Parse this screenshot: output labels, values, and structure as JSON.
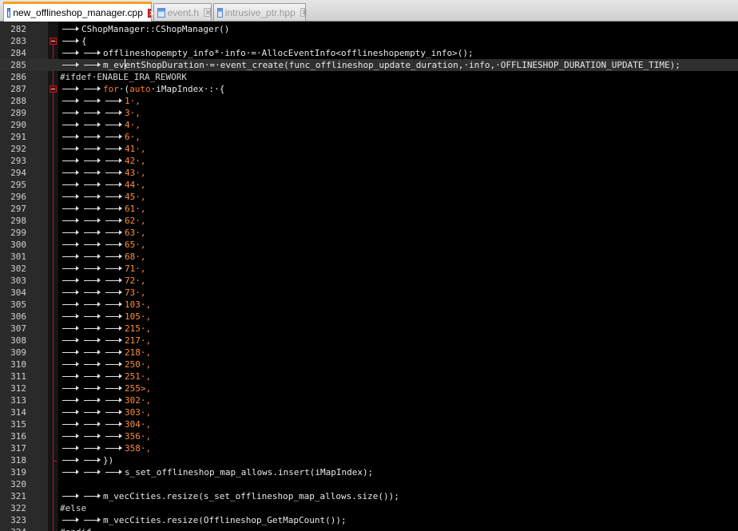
{
  "tabs": [
    {
      "label": "new_offlineshop_manager.cpp",
      "active": true
    },
    {
      "label": "event.h",
      "active": false
    },
    {
      "label": "intrusive_ptr.hpp",
      "active": false
    }
  ],
  "lines": [
    {
      "n": "282",
      "indent": 1,
      "segs": [
        {
          "t": "CShopManager::CShopManager()",
          "c": "plain"
        }
      ]
    },
    {
      "n": "283",
      "indent": 1,
      "segs": [
        {
          "t": "{",
          "c": "plain"
        }
      ]
    },
    {
      "n": "284",
      "indent": 2,
      "segs": [
        {
          "t": "offlineshopempty_info*·info·=·AllocEventInfo<offlineshopempty_info>();",
          "c": "plain"
        }
      ]
    },
    {
      "n": "285",
      "indent": 2,
      "current": true,
      "segs": [
        {
          "t": "m_ev",
          "c": "plain"
        },
        {
          "t": "",
          "c": "cursor"
        },
        {
          "t": "entShopDuration·=·event_create(func_offlineshop_update_duration,·info,·OFFLINESHOP_DURATION_UPDATE_TIME);",
          "c": "plain"
        }
      ]
    },
    {
      "n": "286",
      "indent": 0,
      "segs": [
        {
          "t": "#ifdef·ENABLE_IRA_REWORK",
          "c": "pp"
        }
      ]
    },
    {
      "n": "287",
      "indent": 2,
      "segs": [
        {
          "t": "for",
          "c": "kw"
        },
        {
          "t": "·(",
          "c": "plain"
        },
        {
          "t": "auto",
          "c": "kw"
        },
        {
          "t": "·iMapIndex·:·{",
          "c": "plain"
        }
      ]
    },
    {
      "n": "288",
      "indent": 3,
      "segs": [
        {
          "t": "1·,",
          "c": "num"
        }
      ]
    },
    {
      "n": "289",
      "indent": 3,
      "segs": [
        {
          "t": "3·,",
          "c": "num"
        }
      ]
    },
    {
      "n": "290",
      "indent": 3,
      "segs": [
        {
          "t": "4·,",
          "c": "num"
        }
      ]
    },
    {
      "n": "291",
      "indent": 3,
      "segs": [
        {
          "t": "6·,",
          "c": "num"
        }
      ]
    },
    {
      "n": "292",
      "indent": 3,
      "segs": [
        {
          "t": "41·,",
          "c": "num"
        }
      ]
    },
    {
      "n": "293",
      "indent": 3,
      "segs": [
        {
          "t": "42·,",
          "c": "num"
        }
      ]
    },
    {
      "n": "294",
      "indent": 3,
      "segs": [
        {
          "t": "43·,",
          "c": "num"
        }
      ]
    },
    {
      "n": "295",
      "indent": 3,
      "segs": [
        {
          "t": "44·,",
          "c": "num"
        }
      ]
    },
    {
      "n": "296",
      "indent": 3,
      "segs": [
        {
          "t": "45·,",
          "c": "num"
        }
      ]
    },
    {
      "n": "297",
      "indent": 3,
      "segs": [
        {
          "t": "61·,",
          "c": "num"
        }
      ]
    },
    {
      "n": "298",
      "indent": 3,
      "segs": [
        {
          "t": "62·,",
          "c": "num"
        }
      ]
    },
    {
      "n": "299",
      "indent": 3,
      "segs": [
        {
          "t": "63·,",
          "c": "num"
        }
      ]
    },
    {
      "n": "300",
      "indent": 3,
      "segs": [
        {
          "t": "65·,",
          "c": "num"
        }
      ]
    },
    {
      "n": "301",
      "indent": 3,
      "segs": [
        {
          "t": "68·,",
          "c": "num"
        }
      ]
    },
    {
      "n": "302",
      "indent": 3,
      "segs": [
        {
          "t": "71·,",
          "c": "num"
        }
      ]
    },
    {
      "n": "303",
      "indent": 3,
      "segs": [
        {
          "t": "72·,",
          "c": "num"
        }
      ]
    },
    {
      "n": "304",
      "indent": 3,
      "segs": [
        {
          "t": "73·,",
          "c": "num"
        }
      ]
    },
    {
      "n": "305",
      "indent": 3,
      "segs": [
        {
          "t": "103·,",
          "c": "num"
        }
      ]
    },
    {
      "n": "306",
      "indent": 3,
      "segs": [
        {
          "t": "105·,",
          "c": "num"
        }
      ]
    },
    {
      "n": "307",
      "indent": 3,
      "segs": [
        {
          "t": "215·,",
          "c": "num"
        }
      ]
    },
    {
      "n": "308",
      "indent": 3,
      "segs": [
        {
          "t": "217·,",
          "c": "num"
        }
      ]
    },
    {
      "n": "309",
      "indent": 3,
      "segs": [
        {
          "t": "218·,",
          "c": "num"
        }
      ]
    },
    {
      "n": "310",
      "indent": 3,
      "segs": [
        {
          "t": "250·,",
          "c": "num"
        }
      ]
    },
    {
      "n": "311",
      "indent": 3,
      "segs": [
        {
          "t": "251·,",
          "c": "num"
        }
      ]
    },
    {
      "n": "312",
      "indent": 3,
      "segs": [
        {
          "t": "255>,",
          "c": "num"
        }
      ]
    },
    {
      "n": "313",
      "indent": 3,
      "segs": [
        {
          "t": "302·,",
          "c": "num"
        }
      ]
    },
    {
      "n": "314",
      "indent": 3,
      "segs": [
        {
          "t": "303·,",
          "c": "num"
        }
      ]
    },
    {
      "n": "315",
      "indent": 3,
      "segs": [
        {
          "t": "304·,",
          "c": "num"
        }
      ]
    },
    {
      "n": "316",
      "indent": 3,
      "segs": [
        {
          "t": "356·,",
          "c": "num"
        }
      ]
    },
    {
      "n": "317",
      "indent": 3,
      "segs": [
        {
          "t": "358·,",
          "c": "num"
        }
      ]
    },
    {
      "n": "318",
      "indent": 2,
      "segs": [
        {
          "t": "})",
          "c": "plain"
        }
      ]
    },
    {
      "n": "319",
      "indent": 3,
      "segs": [
        {
          "t": "s_set_offlineshop_map_allows.insert(iMapIndex);",
          "c": "plain"
        }
      ]
    },
    {
      "n": "320",
      "indent": 0,
      "segs": [
        {
          "t": "",
          "c": "plain"
        }
      ]
    },
    {
      "n": "321",
      "indent": 2,
      "segs": [
        {
          "t": "m_vecCities.resize(s_set_offlineshop_map_allows.size());",
          "c": "plain"
        }
      ]
    },
    {
      "n": "322",
      "indent": 0,
      "segs": [
        {
          "t": "#else",
          "c": "pp"
        }
      ]
    },
    {
      "n": "323",
      "indent": 2,
      "segs": [
        {
          "t": "m_vecCities.resize(Offlineshop_GetMapCount());",
          "c": "plain"
        }
      ]
    },
    {
      "n": "324",
      "indent": 0,
      "segs": [
        {
          "t": "#endif",
          "c": "pp"
        }
      ]
    }
  ],
  "colors": {
    "background": "#000000",
    "gutter": "#2a2a2a",
    "fold_marker": "#c0161c",
    "number": "#ff8c3a",
    "keyword": "#ff7b29",
    "active_tab_accent": "#f7a21b"
  }
}
